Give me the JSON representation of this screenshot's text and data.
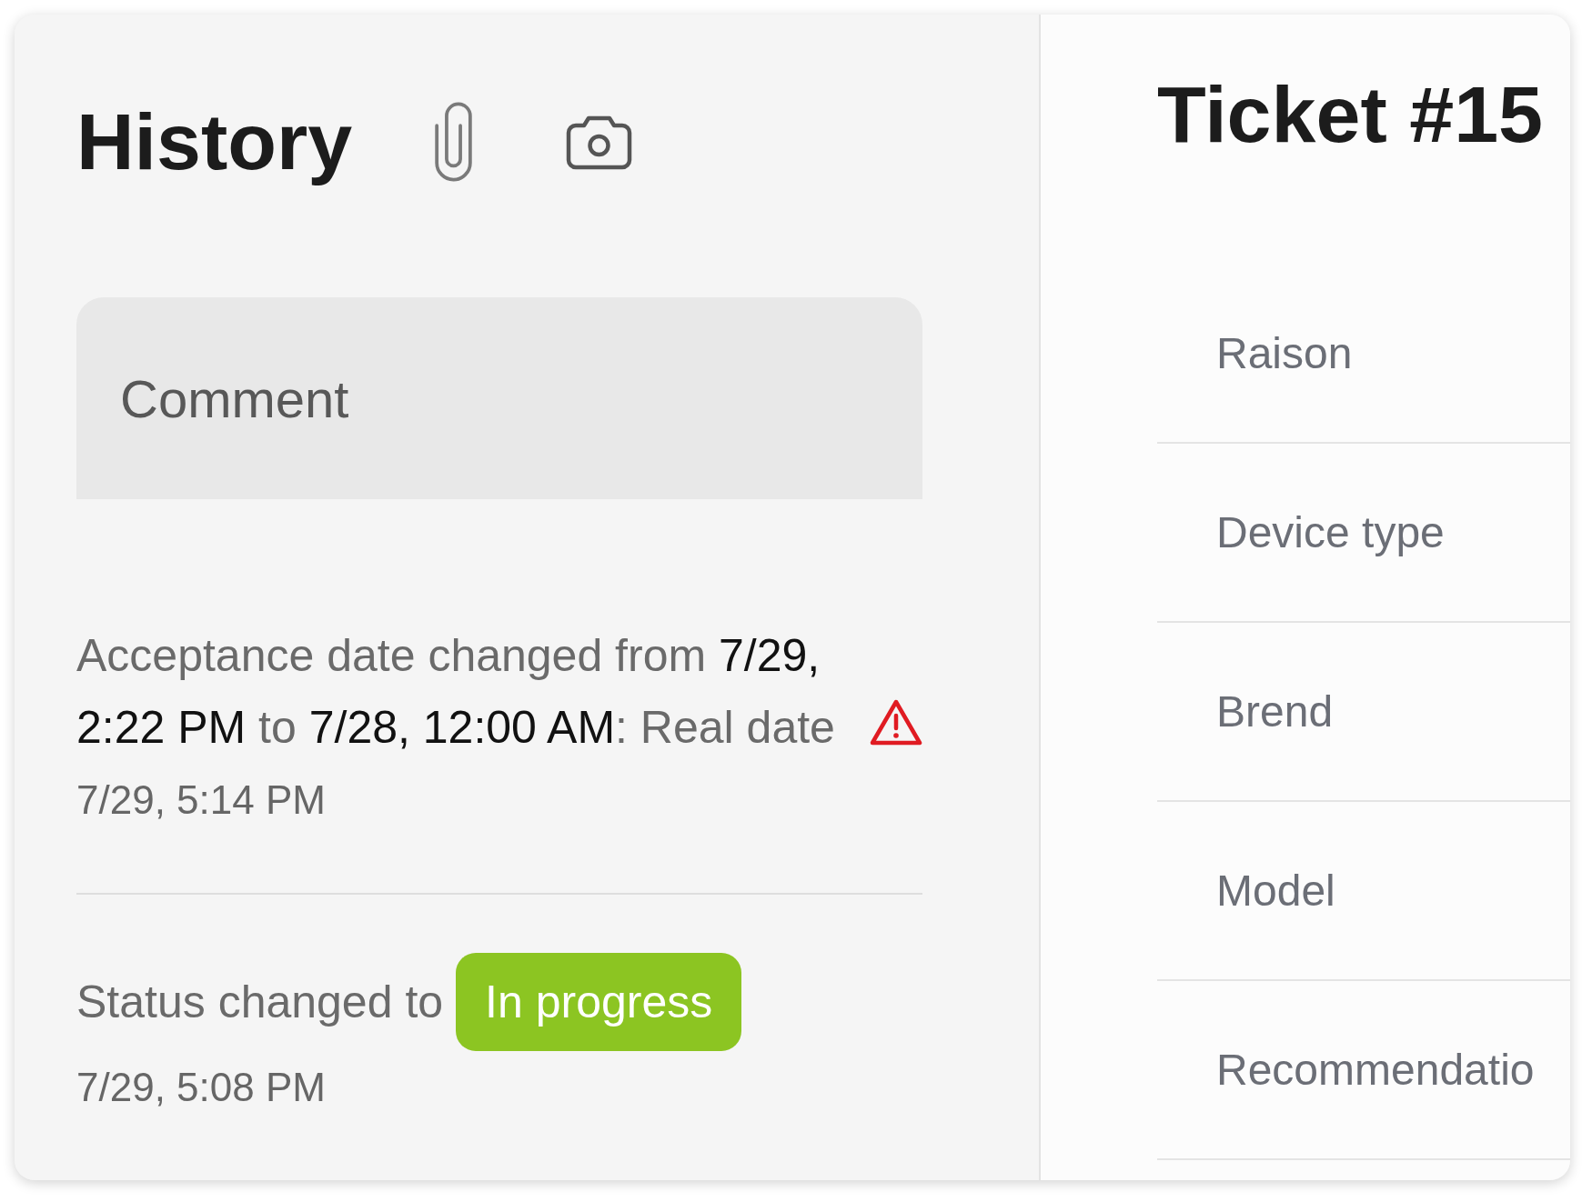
{
  "history": {
    "title": "History",
    "comment": {
      "placeholder": "Comment"
    },
    "entries": [
      {
        "kind": "change",
        "text": "Acceptance date changed from **7/29, 2:22 PM** to **7/28, 12:00 AM**: Real date",
        "warning": true,
        "time": "7/29, 5:14 PM"
      },
      {
        "kind": "status",
        "text": "Status changed to",
        "status": {
          "label": "In progress",
          "color": "#8cc522"
        },
        "time": "7/29, 5:08 PM"
      }
    ]
  },
  "ticket": {
    "title": "Ticket #15",
    "fields": [
      {
        "placeholder": "Raison"
      },
      {
        "placeholder": "Device type"
      },
      {
        "placeholder": "Brend"
      },
      {
        "placeholder": "Model"
      },
      {
        "placeholder": "Recommendatio"
      }
    ]
  }
}
